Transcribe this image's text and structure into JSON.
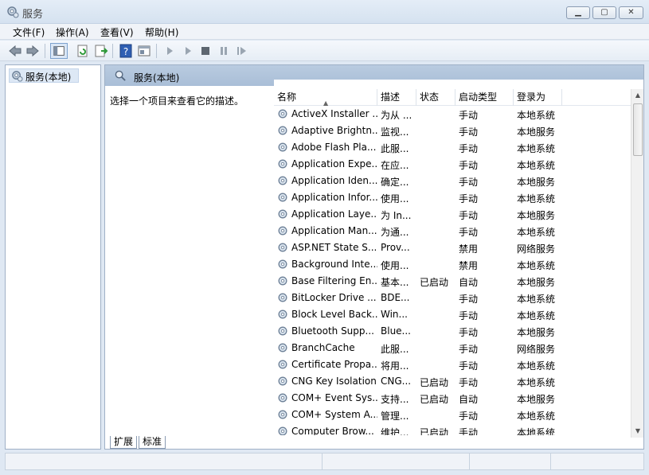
{
  "window": {
    "title": "服务"
  },
  "menu": {
    "items": [
      "文件(F)",
      "操作(A)",
      "查看(V)",
      "帮助(H)"
    ]
  },
  "tree": {
    "root_label": "服务(本地)"
  },
  "main": {
    "header": "服务(本地)",
    "description_hint": "选择一个项目来查看它的描述。"
  },
  "list": {
    "columns": [
      "名称",
      "描述",
      "状态",
      "启动类型",
      "登录为"
    ],
    "rows": [
      [
        "ActiveX Installer ...",
        "为从 ...",
        "",
        "手动",
        "本地系统"
      ],
      [
        "Adaptive Brightn...",
        "监视...",
        "",
        "手动",
        "本地服务"
      ],
      [
        "Adobe Flash Pla...",
        "此服...",
        "",
        "手动",
        "本地系统"
      ],
      [
        "Application Expe...",
        "在应...",
        "",
        "手动",
        "本地系统"
      ],
      [
        "Application Iden...",
        "确定...",
        "",
        "手动",
        "本地服务"
      ],
      [
        "Application Infor...",
        "使用...",
        "",
        "手动",
        "本地系统"
      ],
      [
        "Application Laye...",
        "为 In...",
        "",
        "手动",
        "本地服务"
      ],
      [
        "Application Man...",
        "为通...",
        "",
        "手动",
        "本地系统"
      ],
      [
        "ASP.NET State S...",
        "Prov...",
        "",
        "禁用",
        "网络服务"
      ],
      [
        "Background Inte...",
        "使用...",
        "",
        "禁用",
        "本地系统"
      ],
      [
        "Base Filtering En...",
        "基本...",
        "已启动",
        "自动",
        "本地服务"
      ],
      [
        "BitLocker Drive ...",
        "BDE...",
        "",
        "手动",
        "本地系统"
      ],
      [
        "Block Level Back...",
        "Win...",
        "",
        "手动",
        "本地系统"
      ],
      [
        "Bluetooth Supp...",
        "Blue...",
        "",
        "手动",
        "本地服务"
      ],
      [
        "BranchCache",
        "此服...",
        "",
        "手动",
        "网络服务"
      ],
      [
        "Certificate Propa...",
        "将用...",
        "",
        "手动",
        "本地系统"
      ],
      [
        "CNG Key Isolation",
        "CNG...",
        "已启动",
        "手动",
        "本地系统"
      ],
      [
        "COM+ Event Sys...",
        "支持...",
        "已启动",
        "自动",
        "本地服务"
      ],
      [
        "COM+ System A...",
        "管理...",
        "",
        "手动",
        "本地系统"
      ],
      [
        "Computer Brow...",
        "维护...",
        "已启动",
        "手动",
        "本地系统"
      ]
    ]
  },
  "tabs": [
    "扩展",
    "标准"
  ],
  "colors": {
    "accent": "#a9bed7",
    "window_bg": "#dfe8f3"
  }
}
